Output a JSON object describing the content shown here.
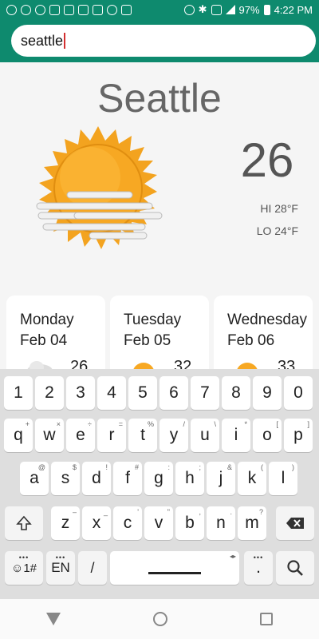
{
  "status_bar": {
    "battery": "97%",
    "time": "4:22 PM",
    "icons": [
      "notification-icon",
      "notification-icon",
      "sync-icon",
      "voicemail-icon",
      "image-icon",
      "usb-icon",
      "vpn-icon",
      "shield-icon",
      "location-icon",
      "bluetooth-icon",
      "nfc-icon",
      "signal-icon",
      "battery-icon"
    ]
  },
  "search": {
    "value": "seattle"
  },
  "weather": {
    "city": "Seattle",
    "temperature": "26",
    "hi": "HI 28°F",
    "lo": "LO 24°F",
    "condition_icon": "sun-fog-icon"
  },
  "forecast": [
    {
      "day": "Monday",
      "date": "Feb 04",
      "temp": "26",
      "icon": "cloud-icon"
    },
    {
      "day": "Tuesday",
      "date": "Feb 05",
      "temp": "32",
      "icon": "sun-icon"
    },
    {
      "day": "Wednesday",
      "date": "Feb 06",
      "temp": "33",
      "icon": "sun-icon"
    }
  ],
  "keyboard": {
    "numbers": [
      "1",
      "2",
      "3",
      "4",
      "5",
      "6",
      "7",
      "8",
      "9",
      "0"
    ],
    "row1": [
      "q",
      "w",
      "e",
      "r",
      "t",
      "y",
      "u",
      "i",
      "o",
      "p"
    ],
    "row1_hints": [
      "+",
      "×",
      "÷",
      "=",
      "%",
      "/",
      "\\",
      "*",
      "[",
      "]"
    ],
    "row2": [
      "a",
      "s",
      "d",
      "f",
      "g",
      "h",
      "j",
      "k",
      "l"
    ],
    "row2_hints": [
      "@",
      "$",
      "!",
      "#",
      ":",
      ";",
      "&",
      "(",
      ")"
    ],
    "row3": [
      "z",
      "x",
      "c",
      "v",
      "b",
      "n",
      "m"
    ],
    "row3_hints": [
      "–",
      "_",
      "'",
      "\"",
      ",",
      ".",
      "?"
    ],
    "symbols_label": "☺1#",
    "lang_label": "EN",
    "slash_label": "/",
    "dot_label": ".",
    "shift_icon": "shift-icon",
    "backspace_icon": "backspace-icon",
    "search_icon": "search-icon"
  },
  "colors": {
    "app_bar": "#0e8a6e",
    "sun": "#f5a623"
  }
}
